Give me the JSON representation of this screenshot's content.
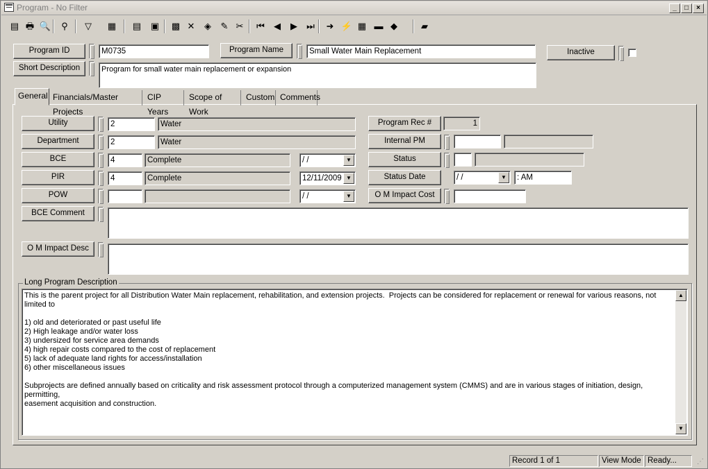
{
  "window": {
    "title": "Program - No Filter",
    "min": "_",
    "max": "□",
    "close": "×"
  },
  "toolbar": {
    "icons": [
      "new-icon",
      "print-icon",
      "print-preview-icon",
      "find-icon",
      "filter-icon",
      "report-icon",
      "properties-icon",
      "copy-icon",
      "save-icon",
      "delete-icon",
      "layers-icon",
      "edit-icon",
      "cut-icon",
      "first-record-icon",
      "prev-record-icon",
      "next-record-icon",
      "last-record-icon",
      "goto-icon",
      "lightning-icon",
      "gallery-icon",
      "highlight-icon",
      "book-icon",
      "export-icon"
    ],
    "glyphs": [
      "▤",
      "🖶",
      "🔍",
      "⚲",
      "▽",
      "▦",
      "▤",
      "▣",
      "▩",
      "✕",
      "◈",
      "✎",
      "✂",
      "⏮",
      "◀",
      "▶",
      "⏭",
      "➜",
      "⚡",
      "▦",
      "▬",
      "◆",
      "▰"
    ]
  },
  "header": {
    "program_id_label": "Program ID",
    "program_id_value": "M0735",
    "program_name_label": "Program Name",
    "program_name_value": "Small Water Main Replacement",
    "inactive_label": "Inactive",
    "short_desc_label": "Short Description",
    "short_desc_value": "Program for small water main replacement or expansion"
  },
  "tabs": [
    "General",
    "Financials/Master Projects",
    "CIP Years",
    "Scope of Work",
    "Custom",
    "Comments"
  ],
  "general": {
    "utility_label": "Utility",
    "utility_code": "2",
    "utility_name": "Water",
    "department_label": "Department",
    "department_code": "2",
    "department_name": "Water",
    "bce_label": "BCE",
    "bce_code": "4",
    "bce_name": "Complete",
    "bce_date": " / /",
    "pir_label": "PIR",
    "pir_code": "4",
    "pir_name": "Complete",
    "pir_date": "12/11/2009",
    "pow_label": "POW",
    "pow_code": "",
    "pow_name": "",
    "pow_date": " / /",
    "bce_comment_label": "BCE Comment",
    "om_impact_desc_label": "O M Impact Desc",
    "program_rec_label": "Program Rec #",
    "program_rec_value": "1",
    "internal_pm_label": "Internal PM",
    "status_label": "Status",
    "status_date_label": "Status Date",
    "status_date_value": " / /",
    "status_time_value": " :  AM",
    "om_impact_cost_label": "O M Impact Cost"
  },
  "long_desc": {
    "label": "Long Program Description",
    "text": "This is the parent project for all Distribution Water Main replacement, rehabilitation, and extension projects.  Projects can be considered for replacement or renewal for various reasons, not limited to\n\n1) old and deteriorated or past useful life\n2) High leakage and/or water loss\n3) undersized for service area demands\n4) high repair costs compared to the cost of replacement\n5) lack of adequate land rights for access/installation\n6) other miscellaneous issues\n\nSubprojects are defined annually based on criticality and risk assessment protocol through a computerized management system (CMMS) and are in various stages of initiation, design, permitting,\neasement acquisition and construction."
  },
  "status": {
    "record": "Record 1 of 1",
    "mode": "View Mode",
    "state": "Ready..."
  }
}
